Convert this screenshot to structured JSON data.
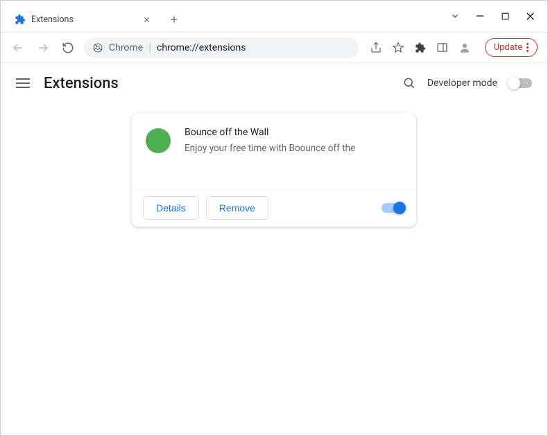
{
  "tab": {
    "title": "Extensions"
  },
  "toolbar": {
    "chrome_label": "Chrome",
    "url": "chrome://extensions",
    "update_label": "Update"
  },
  "page": {
    "title": "Extensions",
    "dev_mode_label": "Developer mode"
  },
  "extension": {
    "name": "Bounce off the Wall",
    "description": "Enjoy your free time with Boounce off the",
    "icon_color": "#4CAF50",
    "details_label": "Details",
    "remove_label": "Remove",
    "enabled": true
  }
}
